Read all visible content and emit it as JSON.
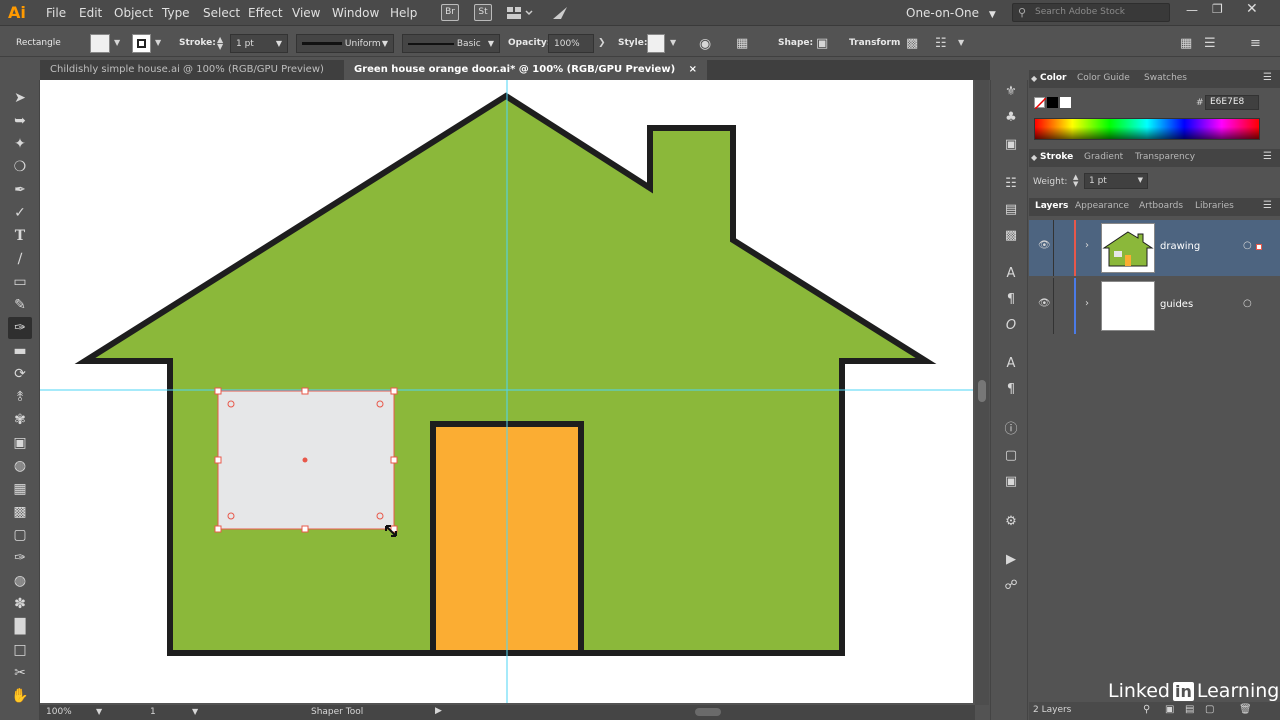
{
  "app": {
    "logo": "Ai"
  },
  "menu": [
    "File",
    "Edit",
    "Object",
    "Type",
    "Select",
    "Effect",
    "View",
    "Window",
    "Help"
  ],
  "toolbar_icons": {
    "bridge": "Br",
    "stock": "St"
  },
  "workspace": "One-on-One",
  "search": {
    "placeholder": "Search Adobe Stock"
  },
  "control": {
    "tool": "Rectangle",
    "stroke_label": "Stroke:",
    "stroke_value": "1 pt",
    "profile": "Uniform",
    "brush": "Basic",
    "opacity_label": "Opacity:",
    "opacity_value": "100%",
    "style_label": "Style:",
    "shape_label": "Shape:",
    "transform_label": "Transform"
  },
  "tabs": [
    {
      "label": "Childishly simple house.ai @ 100% (RGB/GPU Preview)",
      "active": false
    },
    {
      "label": "Green house orange door.ai* @ 100% (RGB/GPU Preview)",
      "active": true,
      "close": "×"
    }
  ],
  "panels": {
    "color_tabs": [
      "Color",
      "Color Guide",
      "Swatches"
    ],
    "hex_value": "E6E7E8",
    "hex_prefix": "#",
    "stroke_tabs": [
      "Stroke",
      "Gradient",
      "Transparency"
    ],
    "weight_label": "Weight:",
    "weight_value": "1 pt",
    "layer_tabs": [
      "Layers",
      "Appearance",
      "Artboards",
      "Libraries"
    ],
    "layers": [
      {
        "name": "drawing",
        "selected": true,
        "color": "#e8584a"
      },
      {
        "name": "guides",
        "selected": false,
        "color": "#4a7be8"
      }
    ],
    "layer_count": "2 Layers"
  },
  "status": {
    "zoom": "100%",
    "artboard": "1",
    "tool": "Shaper Tool"
  },
  "watermark": {
    "linked": "Linked",
    "in": "in",
    "learning": "Learning"
  },
  "colors": {
    "house_fill": "#8bb83a",
    "house_stroke": "#1e1e1e",
    "door_fill": "#fbad33",
    "window_fill": "#e6e7e8",
    "guide": "#4dd6f5",
    "selection": "#e8584a"
  }
}
